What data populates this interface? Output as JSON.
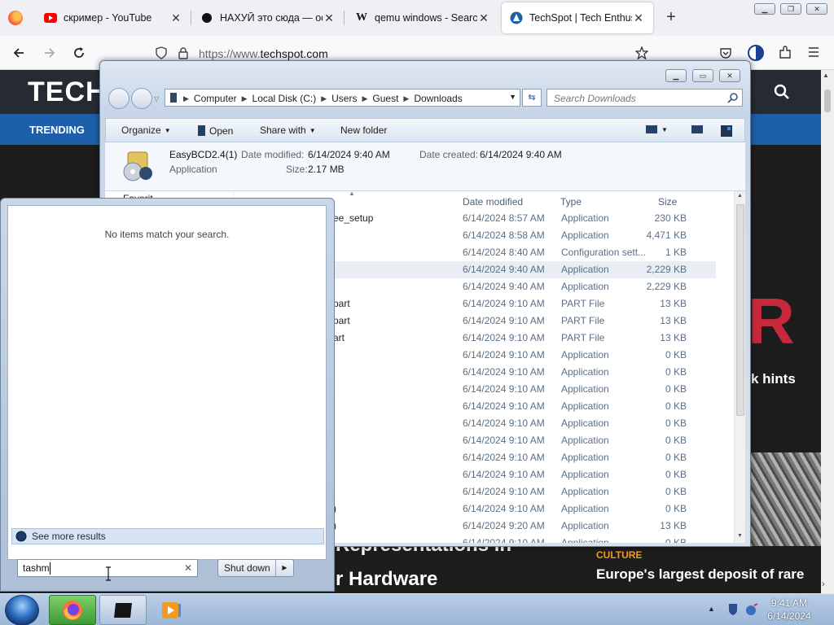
{
  "browser": {
    "tabs": [
      {
        "title": "скример - YouTube",
        "icon": "youtube-icon",
        "active": false
      },
      {
        "title": "НАХУЙ это сюда — оф",
        "icon": "black-circle-site-icon",
        "active": false
      },
      {
        "title": "qemu windows - Search",
        "icon": "wikipedia-icon",
        "active": false
      },
      {
        "title": "TechSpot | Tech Enthusia",
        "icon": "techspot-icon",
        "active": true
      }
    ],
    "url_prefix": "https://www.",
    "url_domain": "techspot.com",
    "window_controls": [
      "minimize",
      "restore",
      "close"
    ]
  },
  "webpage": {
    "logo": "TECH",
    "trending_label": "TRENDING",
    "hint_fragment": "k hints",
    "headline_fragment_1": "Representations in",
    "headline_fragment_2": "r Hardware",
    "culture_label": "CULTURE",
    "culture_title": "Europe's largest deposit of rare",
    "accent_color": "#1e5faa"
  },
  "explorer": {
    "breadcrumb": [
      "Computer",
      "Local Disk (C:)",
      "Users",
      "Guest",
      "Downloads"
    ],
    "search_placeholder": "Search Downloads",
    "toolbar": {
      "organize": "Organize",
      "open": "Open",
      "share_with": "Share with",
      "new_folder": "New folder"
    },
    "details": {
      "name": "EasyBCD2.4(1)",
      "kind": "Application",
      "modified_label": "Date modified:",
      "modified_value": "6/14/2024 9:40 AM",
      "created_label": "Date created:",
      "created_value": "6/14/2024 9:40 AM",
      "size_label": "Size:",
      "size_value": "2.17 MB"
    },
    "nav_fragment": "Favorit",
    "columns": {
      "name": "Name",
      "date": "Date modified",
      "type": "Type",
      "size": "Size"
    },
    "files": [
      {
        "name": "ee_setup",
        "date": "6/14/2024 8:57 AM",
        "type": "Application",
        "size": "230 KB"
      },
      {
        "name": "",
        "date": "6/14/2024 8:58 AM",
        "type": "Application",
        "size": "4,471 KB"
      },
      {
        "name": "",
        "date": "6/14/2024 8:40 AM",
        "type": "Configuration sett...",
        "size": "1 KB"
      },
      {
        "name": "",
        "date": "6/14/2024 9:40 AM",
        "type": "Application",
        "size": "2,229 KB",
        "selected": true
      },
      {
        "name": "",
        "date": "6/14/2024 9:40 AM",
        "type": "Application",
        "size": "2,229 KB"
      },
      {
        "name": "part",
        "date": "6/14/2024 9:10 AM",
        "type": "PART File",
        "size": "13 KB"
      },
      {
        "name": "part",
        "date": "6/14/2024 9:10 AM",
        "type": "PART File",
        "size": "13 KB"
      },
      {
        "name": "art",
        "date": "6/14/2024 9:10 AM",
        "type": "PART File",
        "size": "13 KB"
      },
      {
        "name": "",
        "date": "6/14/2024 9:10 AM",
        "type": "Application",
        "size": "0 KB"
      },
      {
        "name": "",
        "date": "6/14/2024 9:10 AM",
        "type": "Application",
        "size": "0 KB"
      },
      {
        "name": "",
        "date": "6/14/2024 9:10 AM",
        "type": "Application",
        "size": "0 KB"
      },
      {
        "name": "",
        "date": "6/14/2024 9:10 AM",
        "type": "Application",
        "size": "0 KB"
      },
      {
        "name": "",
        "date": "6/14/2024 9:10 AM",
        "type": "Application",
        "size": "0 KB"
      },
      {
        "name": "",
        "date": "6/14/2024 9:10 AM",
        "type": "Application",
        "size": "0 KB"
      },
      {
        "name": "",
        "date": "6/14/2024 9:10 AM",
        "type": "Application",
        "size": "0 KB"
      },
      {
        "name": "",
        "date": "6/14/2024 9:10 AM",
        "type": "Application",
        "size": "0 KB"
      },
      {
        "name": "",
        "date": "6/14/2024 9:10 AM",
        "type": "Application",
        "size": "0 KB"
      },
      {
        "name": ")",
        "date": "6/14/2024 9:10 AM",
        "type": "Application",
        "size": "0 KB"
      },
      {
        "name": ")",
        "date": "6/14/2024 9:20 AM",
        "type": "Application",
        "size": "13 KB"
      },
      {
        "name": "",
        "date": "6/14/2024 9:10 AM",
        "type": "Application",
        "size": "0 KB"
      }
    ]
  },
  "start_menu": {
    "no_items": "No items match your search.",
    "see_more": "See more results",
    "search_value": "tashm",
    "shutdown_label": "Shut down"
  },
  "taskbar": {
    "apps": [
      "firefox-icon",
      "terminal-icon",
      "media-player-icon"
    ],
    "time": "9:41 AM",
    "date": "6/14/2024"
  }
}
